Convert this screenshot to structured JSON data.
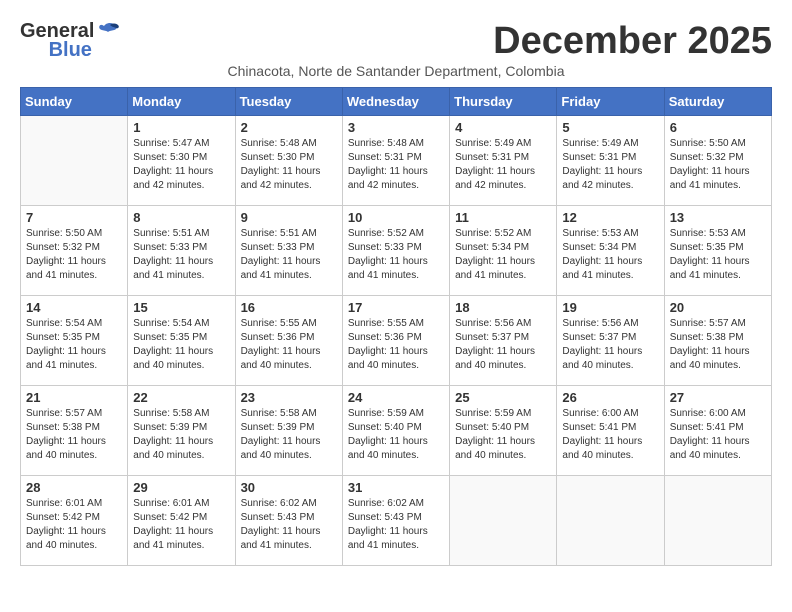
{
  "logo": {
    "line1": "General",
    "line2": "Blue"
  },
  "title": "December 2025",
  "location": "Chinacota, Norte de Santander Department, Colombia",
  "headers": [
    "Sunday",
    "Monday",
    "Tuesday",
    "Wednesday",
    "Thursday",
    "Friday",
    "Saturday"
  ],
  "weeks": [
    [
      {
        "day": "",
        "sunrise": "",
        "sunset": "",
        "daylight": ""
      },
      {
        "day": "1",
        "sunrise": "Sunrise: 5:47 AM",
        "sunset": "Sunset: 5:30 PM",
        "daylight": "Daylight: 11 hours and 42 minutes."
      },
      {
        "day": "2",
        "sunrise": "Sunrise: 5:48 AM",
        "sunset": "Sunset: 5:30 PM",
        "daylight": "Daylight: 11 hours and 42 minutes."
      },
      {
        "day": "3",
        "sunrise": "Sunrise: 5:48 AM",
        "sunset": "Sunset: 5:31 PM",
        "daylight": "Daylight: 11 hours and 42 minutes."
      },
      {
        "day": "4",
        "sunrise": "Sunrise: 5:49 AM",
        "sunset": "Sunset: 5:31 PM",
        "daylight": "Daylight: 11 hours and 42 minutes."
      },
      {
        "day": "5",
        "sunrise": "Sunrise: 5:49 AM",
        "sunset": "Sunset: 5:31 PM",
        "daylight": "Daylight: 11 hours and 42 minutes."
      },
      {
        "day": "6",
        "sunrise": "Sunrise: 5:50 AM",
        "sunset": "Sunset: 5:32 PM",
        "daylight": "Daylight: 11 hours and 41 minutes."
      }
    ],
    [
      {
        "day": "7",
        "sunrise": "Sunrise: 5:50 AM",
        "sunset": "Sunset: 5:32 PM",
        "daylight": "Daylight: 11 hours and 41 minutes."
      },
      {
        "day": "8",
        "sunrise": "Sunrise: 5:51 AM",
        "sunset": "Sunset: 5:33 PM",
        "daylight": "Daylight: 11 hours and 41 minutes."
      },
      {
        "day": "9",
        "sunrise": "Sunrise: 5:51 AM",
        "sunset": "Sunset: 5:33 PM",
        "daylight": "Daylight: 11 hours and 41 minutes."
      },
      {
        "day": "10",
        "sunrise": "Sunrise: 5:52 AM",
        "sunset": "Sunset: 5:33 PM",
        "daylight": "Daylight: 11 hours and 41 minutes."
      },
      {
        "day": "11",
        "sunrise": "Sunrise: 5:52 AM",
        "sunset": "Sunset: 5:34 PM",
        "daylight": "Daylight: 11 hours and 41 minutes."
      },
      {
        "day": "12",
        "sunrise": "Sunrise: 5:53 AM",
        "sunset": "Sunset: 5:34 PM",
        "daylight": "Daylight: 11 hours and 41 minutes."
      },
      {
        "day": "13",
        "sunrise": "Sunrise: 5:53 AM",
        "sunset": "Sunset: 5:35 PM",
        "daylight": "Daylight: 11 hours and 41 minutes."
      }
    ],
    [
      {
        "day": "14",
        "sunrise": "Sunrise: 5:54 AM",
        "sunset": "Sunset: 5:35 PM",
        "daylight": "Daylight: 11 hours and 41 minutes."
      },
      {
        "day": "15",
        "sunrise": "Sunrise: 5:54 AM",
        "sunset": "Sunset: 5:35 PM",
        "daylight": "Daylight: 11 hours and 40 minutes."
      },
      {
        "day": "16",
        "sunrise": "Sunrise: 5:55 AM",
        "sunset": "Sunset: 5:36 PM",
        "daylight": "Daylight: 11 hours and 40 minutes."
      },
      {
        "day": "17",
        "sunrise": "Sunrise: 5:55 AM",
        "sunset": "Sunset: 5:36 PM",
        "daylight": "Daylight: 11 hours and 40 minutes."
      },
      {
        "day": "18",
        "sunrise": "Sunrise: 5:56 AM",
        "sunset": "Sunset: 5:37 PM",
        "daylight": "Daylight: 11 hours and 40 minutes."
      },
      {
        "day": "19",
        "sunrise": "Sunrise: 5:56 AM",
        "sunset": "Sunset: 5:37 PM",
        "daylight": "Daylight: 11 hours and 40 minutes."
      },
      {
        "day": "20",
        "sunrise": "Sunrise: 5:57 AM",
        "sunset": "Sunset: 5:38 PM",
        "daylight": "Daylight: 11 hours and 40 minutes."
      }
    ],
    [
      {
        "day": "21",
        "sunrise": "Sunrise: 5:57 AM",
        "sunset": "Sunset: 5:38 PM",
        "daylight": "Daylight: 11 hours and 40 minutes."
      },
      {
        "day": "22",
        "sunrise": "Sunrise: 5:58 AM",
        "sunset": "Sunset: 5:39 PM",
        "daylight": "Daylight: 11 hours and 40 minutes."
      },
      {
        "day": "23",
        "sunrise": "Sunrise: 5:58 AM",
        "sunset": "Sunset: 5:39 PM",
        "daylight": "Daylight: 11 hours and 40 minutes."
      },
      {
        "day": "24",
        "sunrise": "Sunrise: 5:59 AM",
        "sunset": "Sunset: 5:40 PM",
        "daylight": "Daylight: 11 hours and 40 minutes."
      },
      {
        "day": "25",
        "sunrise": "Sunrise: 5:59 AM",
        "sunset": "Sunset: 5:40 PM",
        "daylight": "Daylight: 11 hours and 40 minutes."
      },
      {
        "day": "26",
        "sunrise": "Sunrise: 6:00 AM",
        "sunset": "Sunset: 5:41 PM",
        "daylight": "Daylight: 11 hours and 40 minutes."
      },
      {
        "day": "27",
        "sunrise": "Sunrise: 6:00 AM",
        "sunset": "Sunset: 5:41 PM",
        "daylight": "Daylight: 11 hours and 40 minutes."
      }
    ],
    [
      {
        "day": "28",
        "sunrise": "Sunrise: 6:01 AM",
        "sunset": "Sunset: 5:42 PM",
        "daylight": "Daylight: 11 hours and 40 minutes."
      },
      {
        "day": "29",
        "sunrise": "Sunrise: 6:01 AM",
        "sunset": "Sunset: 5:42 PM",
        "daylight": "Daylight: 11 hours and 41 minutes."
      },
      {
        "day": "30",
        "sunrise": "Sunrise: 6:02 AM",
        "sunset": "Sunset: 5:43 PM",
        "daylight": "Daylight: 11 hours and 41 minutes."
      },
      {
        "day": "31",
        "sunrise": "Sunrise: 6:02 AM",
        "sunset": "Sunset: 5:43 PM",
        "daylight": "Daylight: 11 hours and 41 minutes."
      },
      {
        "day": "",
        "sunrise": "",
        "sunset": "",
        "daylight": ""
      },
      {
        "day": "",
        "sunrise": "",
        "sunset": "",
        "daylight": ""
      },
      {
        "day": "",
        "sunrise": "",
        "sunset": "",
        "daylight": ""
      }
    ]
  ]
}
